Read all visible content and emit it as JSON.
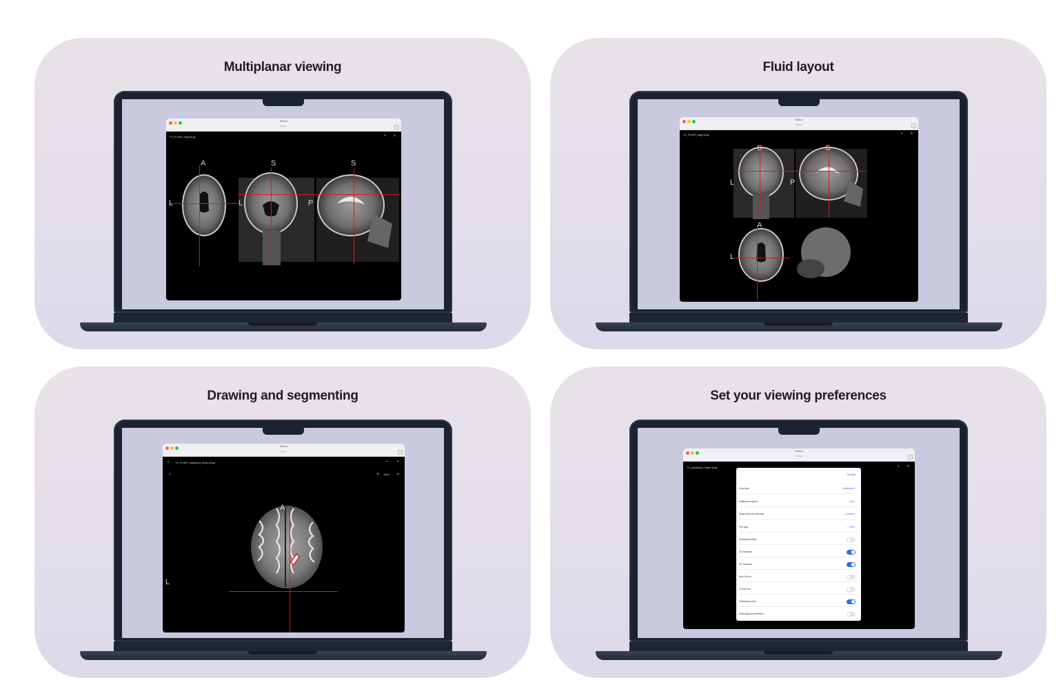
{
  "cards": [
    {
      "title": "Multiplanar viewing",
      "window_title": "NiiVue",
      "window_subtitle": "NiiVue",
      "filename": "T2_FLAIR_orig.nii.gz",
      "labels": [
        "A",
        "L",
        "L",
        "S",
        "S",
        "P"
      ]
    },
    {
      "title": "Fluid layout",
      "window_title": "NiiVue",
      "window_subtitle": "NiiVue",
      "filename": "T2_FLAIR_orig.nii.gz",
      "labels": [
        "S",
        "S",
        "L",
        "P",
        "A",
        "L"
      ]
    },
    {
      "title": "Drawing and segmenting",
      "window_title": "NiiVue",
      "window_subtitle": "NiiVue",
      "filename": "T2_FLAIR_unbiased_brain.nii.gz",
      "slice_label": "Slice",
      "labels": [
        "A",
        "L"
      ]
    },
    {
      "title": "Set your viewing preferences",
      "window_title": "NiiVue",
      "window_subtitle": "NiiVue",
      "filename": "T1_unbiased_brain.nii.gz",
      "dismiss": "Dismiss",
      "settings": [
        {
          "label": "View type",
          "value": "Multiplanar ›"
        },
        {
          "label": "Multiplanar layout",
          "value": "Grid ›"
        },
        {
          "label": "Drag action (double tap)",
          "value": "Contrast ›"
        },
        {
          "label": "Pen type",
          "value": "✓ Red ›"
        },
        {
          "label": "Drawing enabled",
          "toggle": false
        },
        {
          "label": "3D crosshair",
          "toggle": true
        },
        {
          "label": "2D crosshair",
          "toggle": true
        },
        {
          "label": "Auto fill pen",
          "toggle": false
        },
        {
          "label": "Corner text",
          "toggle": false
        },
        {
          "label": "Orientation cube",
          "toggle": true
        },
        {
          "label": "Radiological convention",
          "toggle": false
        }
      ]
    }
  ],
  "colors": {
    "crosshair": "#e01616",
    "accent": "#2f6fe0",
    "card_bg": "#e5e0ea"
  }
}
